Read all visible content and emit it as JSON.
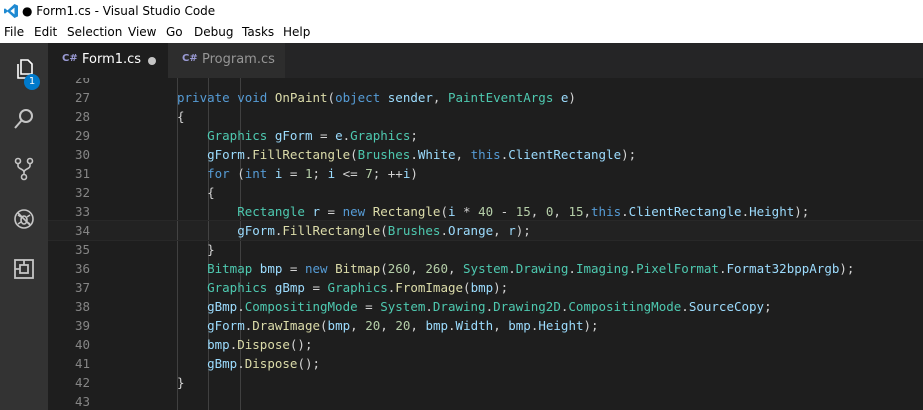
{
  "window": {
    "title": "● Form1.cs - Visual Studio Code"
  },
  "menu": [
    "File",
    "Edit",
    "Selection",
    "View",
    "Go",
    "Debug",
    "Tasks",
    "Help"
  ],
  "activity": {
    "explorer_badge": "1"
  },
  "tabs": [
    {
      "label": "Form1.cs",
      "icon": "C#"
    },
    {
      "label": "Program.cs",
      "icon": "C#"
    }
  ],
  "editor": {
    "lines": [
      {
        "num": "26",
        "text": ""
      },
      {
        "num": "27",
        "text": "private void OnPaint(object sender, PaintEventArgs e)"
      },
      {
        "num": "28",
        "text": "{"
      },
      {
        "num": "29",
        "text": "    Graphics gForm = e.Graphics;"
      },
      {
        "num": "30",
        "text": "    gForm.FillRectangle(Brushes.White, this.ClientRectangle);"
      },
      {
        "num": "31",
        "text": "    for (int i = 1; i <= 7; ++i)"
      },
      {
        "num": "32",
        "text": "    {"
      },
      {
        "num": "33",
        "text": "        Rectangle r = new Rectangle(i * 40 - 15, 0, 15,this.ClientRectangle.Height);"
      },
      {
        "num": "34",
        "text": "        gForm.FillRectangle(Brushes.Orange, r);"
      },
      {
        "num": "35",
        "text": "    }"
      },
      {
        "num": "36",
        "text": "    Bitmap bmp = new Bitmap(260, 260, System.Drawing.Imaging.PixelFormat.Format32bppArgb);"
      },
      {
        "num": "37",
        "text": "    Graphics gBmp = Graphics.FromImage(bmp);"
      },
      {
        "num": "38",
        "text": "    gBmp.CompositingMode = System.Drawing.Drawing2D.CompositingMode.SourceCopy;"
      },
      {
        "num": "39",
        "text": "    gForm.DrawImage(bmp, 20, 20, bmp.Width, bmp.Height);"
      },
      {
        "num": "40",
        "text": "    bmp.Dispose();"
      },
      {
        "num": "41",
        "text": "    gBmp.Dispose();"
      },
      {
        "num": "42",
        "text": "}"
      },
      {
        "num": "43",
        "text": ""
      }
    ]
  }
}
